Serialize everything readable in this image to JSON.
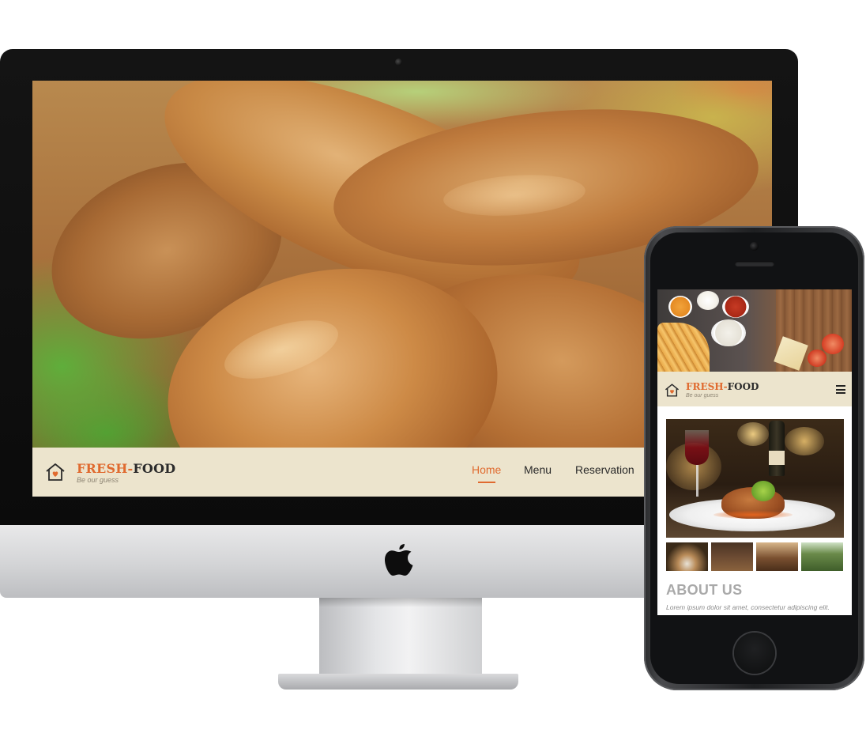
{
  "desktop": {
    "brand": {
      "part1": "FRESH-",
      "part2": "FOOD",
      "tagline": "Be our guess"
    },
    "nav": {
      "items": [
        {
          "label": "Home",
          "active": true
        },
        {
          "label": "Menu",
          "active": false
        },
        {
          "label": "Reservation",
          "active": false
        }
      ]
    },
    "hero_icon": "roast-chicken-photo"
  },
  "mobile": {
    "brand": {
      "part1": "FRESH-",
      "part2": "FOOD",
      "tagline": "Be our guess"
    },
    "menu_icon": "hamburger-menu-icon",
    "section_title": "ABOUT US",
    "intro_text": "Lorem ipsum dolor sit amet, consectetur adipiscing elit."
  },
  "colors": {
    "accent": "#e06a2f",
    "nav_background": "#ece4cd",
    "brand_dark": "#2b2b2b",
    "tagline": "#8d8473"
  }
}
